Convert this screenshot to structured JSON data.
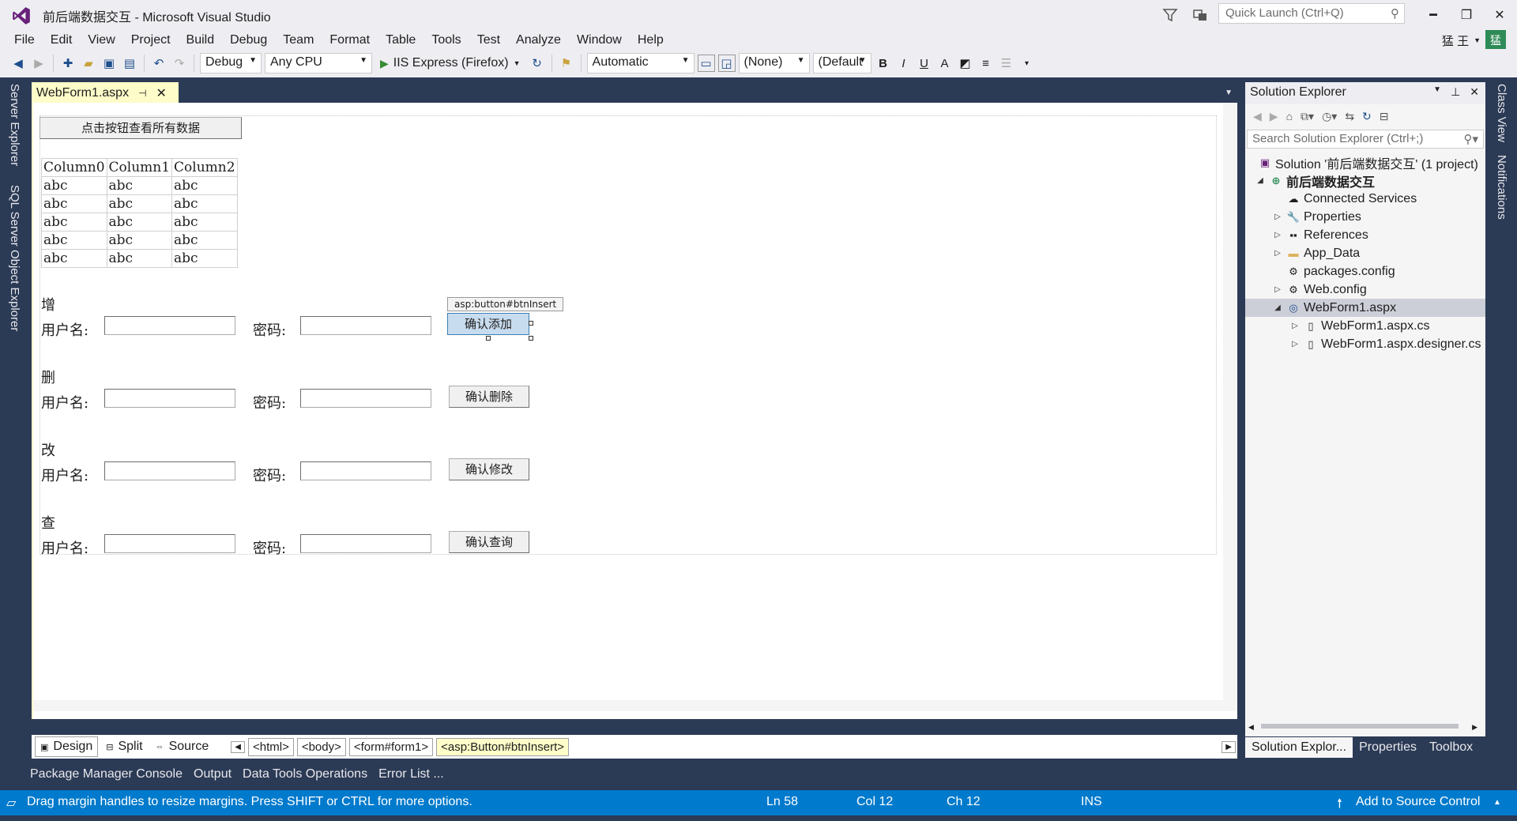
{
  "window": {
    "title": "前后端数据交互 - Microsoft Visual Studio",
    "quick_launch_placeholder": "Quick Launch (Ctrl+Q)",
    "user_name": "猛 王",
    "avatar_letter": "猛"
  },
  "menu": [
    "File",
    "Edit",
    "View",
    "Project",
    "Build",
    "Debug",
    "Team",
    "Format",
    "Table",
    "Tools",
    "Test",
    "Analyze",
    "Window",
    "Help"
  ],
  "toolbar": {
    "configuration": "Debug",
    "platform": "Any CPU",
    "run_target": "IIS Express (Firefox)",
    "automatic": "Automatic",
    "none_style": "(None)",
    "default_font": "(Default",
    "bold": "B",
    "italic": "I",
    "underline": "U"
  },
  "left_strip": [
    "Server Explorer",
    "SQL Server Object Explorer"
  ],
  "right_strip": [
    "Class View",
    "Notifications"
  ],
  "document_tab": "WebForm1.aspx",
  "designer": {
    "top_button": "点击按钮查看所有数据",
    "grid": {
      "columns": [
        "Column0",
        "Column1",
        "Column2"
      ],
      "rows": [
        [
          "abc",
          "abc",
          "abc"
        ],
        [
          "abc",
          "abc",
          "abc"
        ],
        [
          "abc",
          "abc",
          "abc"
        ],
        [
          "abc",
          "abc",
          "abc"
        ],
        [
          "abc",
          "abc",
          "abc"
        ]
      ]
    },
    "selected_tag_hint": "asp:button#btnInsert",
    "username_label": "用户名:",
    "password_label": "密码:",
    "sections": [
      {
        "heading": "增",
        "button": "确认添加"
      },
      {
        "heading": "删",
        "button": "确认删除"
      },
      {
        "heading": "改",
        "button": "确认修改"
      },
      {
        "heading": "查",
        "button": "确认查询"
      }
    ]
  },
  "view_bar": {
    "tabs": [
      "Design",
      "Split",
      "Source"
    ],
    "breadcrumbs": [
      "<html>",
      "<body>",
      "<form#form1>",
      "<asp:Button#btnInsert>"
    ]
  },
  "tool_windows": [
    "Package Manager Console",
    "Output",
    "Data Tools Operations",
    "Error List ..."
  ],
  "status": {
    "message": "Drag margin handles to resize margins. Press SHIFT or CTRL for more options.",
    "ln": "Ln 58",
    "col": "Col 12",
    "ch": "Ch 12",
    "mode": "INS",
    "source_control": "Add to Source Control"
  },
  "solution_explorer": {
    "title": "Solution Explorer",
    "search_placeholder": "Search Solution Explorer (Ctrl+;)",
    "items": [
      {
        "label": "Solution '前后端数据交互' (1 project)",
        "icon": "solution-icon"
      },
      {
        "label": "前后端数据交互",
        "icon": "web-project-icon"
      },
      {
        "label": "Connected Services",
        "icon": "connected-services-icon"
      },
      {
        "label": "Properties",
        "icon": "wrench-icon"
      },
      {
        "label": "References",
        "icon": "references-icon"
      },
      {
        "label": "App_Data",
        "icon": "folder-icon"
      },
      {
        "label": "packages.config",
        "icon": "config-file-icon"
      },
      {
        "label": "Web.config",
        "icon": "config-file-icon"
      },
      {
        "label": "WebForm1.aspx",
        "icon": "aspx-file-icon"
      },
      {
        "label": "WebForm1.aspx.cs",
        "icon": "cs-file-icon"
      },
      {
        "label": "WebForm1.aspx.designer.cs",
        "icon": "cs-file-icon"
      }
    ],
    "bottom_tabs": [
      "Solution Explor...",
      "Properties",
      "Toolbox"
    ]
  },
  "colors": {
    "chrome": "#eeeef2",
    "frame_dark": "#2b3a55",
    "status_blue": "#007acc",
    "active_tab": "#fefcc8"
  }
}
